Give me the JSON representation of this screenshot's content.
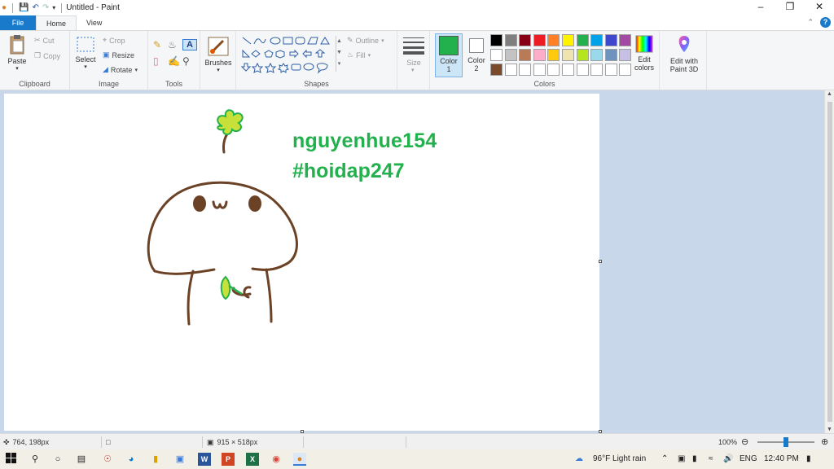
{
  "window": {
    "title": "Untitled - Paint"
  },
  "tabs": {
    "file": "File",
    "home": "Home",
    "view": "View"
  },
  "ribbon": {
    "clipboard": {
      "paste": "Paste",
      "cut": "Cut",
      "copy": "Copy",
      "label": "Clipboard"
    },
    "image": {
      "select": "Select",
      "crop": "Crop",
      "resize": "Resize",
      "rotate": "Rotate",
      "label": "Image"
    },
    "tools": {
      "label": "Tools"
    },
    "brushes": {
      "label": "Brushes"
    },
    "shapes": {
      "outline": "Outline",
      "fill": "Fill",
      "label": "Shapes"
    },
    "size": {
      "label": "Size"
    },
    "color1": {
      "label": "Color",
      "num": "1",
      "value": "#22b14c"
    },
    "color2": {
      "label": "Color",
      "num": "2",
      "value": "#ffffff"
    },
    "colors": {
      "label": "Colors",
      "edit": "Edit colors",
      "edit_line2": "colors",
      "edit_line1": "Edit"
    },
    "paint3d": {
      "line1": "Edit with",
      "line2": "Paint 3D"
    },
    "palette_row1": [
      "#000000",
      "#7f7f7f",
      "#880015",
      "#ed1c24",
      "#ff7f27",
      "#fff200",
      "#22b14c",
      "#00a2e8",
      "#3f48cc",
      "#a349a4"
    ],
    "palette_row2": [
      "#ffffff",
      "#c3c3c3",
      "#b97a57",
      "#ffaec9",
      "#ffc90e",
      "#efe4b0",
      "#b5e61d",
      "#99d9ea",
      "#7092be",
      "#c8bfe7"
    ],
    "palette_row3": [
      "#7a4a2a",
      "#ffffff",
      "#ffffff",
      "#ffffff",
      "#ffffff",
      "#ffffff",
      "#ffffff",
      "#ffffff",
      "#ffffff",
      "#ffffff"
    ]
  },
  "canvas": {
    "text_line1": "nguyenhue154",
    "text_line2": "#hoidap247",
    "ink_brown": "#6b4226",
    "ink_green": "#22b14c",
    "ink_yellow": "#c8e03a"
  },
  "status": {
    "cursor_pos": "764, 198px",
    "canvas_size": "915 × 518px",
    "zoom": "100%"
  },
  "taskbar": {
    "weather": "96°F  Light rain",
    "lang": "ENG",
    "time": "12:40 PM"
  }
}
